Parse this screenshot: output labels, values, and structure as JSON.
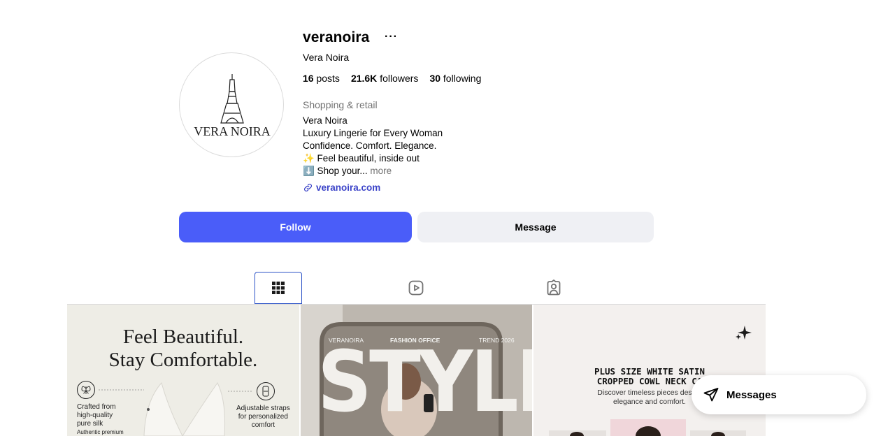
{
  "profile": {
    "username": "veranoira",
    "more_label": "···",
    "full_name": "Vera Noira",
    "stats": {
      "posts_count": "16",
      "posts_label": "posts",
      "followers_count": "21.6K",
      "followers_label": "followers",
      "following_count": "30",
      "following_label": "following"
    },
    "category": "Shopping & retail",
    "bio": {
      "line1": "Vera Noira",
      "line2": "Luxury Lingerie for Every Woman",
      "line3": "Confidence. Comfort. Elegance.",
      "line4": "✨ Feel beautiful, inside out",
      "line5": "⬇️ Shop your...",
      "more": "more"
    },
    "link": "veranoira.com",
    "avatar_text": "VERA NOIRA"
  },
  "actions": {
    "follow_label": "Follow",
    "message_label": "Message"
  },
  "tabs": [
    {
      "name": "posts",
      "icon": "grid-icon",
      "active": true
    },
    {
      "name": "reels",
      "icon": "reels-icon",
      "active": false
    },
    {
      "name": "tagged",
      "icon": "tagged-icon",
      "active": false
    }
  ],
  "posts": [
    {
      "headline_1": "Feel Beautiful.",
      "headline_2": "Stay Comfortable.",
      "feature_left_1": "Crafted from",
      "feature_left_2": "high-quality",
      "feature_left_3": "pure silk",
      "feature_left_4": "Authentic premium",
      "feature_right_1": "Adjustable straps",
      "feature_right_2": "for personalized",
      "feature_right_3": "comfort"
    },
    {
      "brand": "VERANOIRA",
      "office": "FASHION OFFICE",
      "trend": "TREND 2026",
      "big_word": "STYLE"
    },
    {
      "title_1": "PLUS SIZE WHITE SATIN",
      "title_2": "CROPPED COWL NECK CA",
      "desc_1": "Discover timeless pieces design",
      "desc_2": "elegance and comfort."
    }
  ],
  "messages_popup": {
    "label": "Messages"
  },
  "colors": {
    "follow_button": "#4a5df9",
    "message_button": "#eff0f4",
    "link": "#3b43c8",
    "active_tab_border": "#2c53c7"
  }
}
